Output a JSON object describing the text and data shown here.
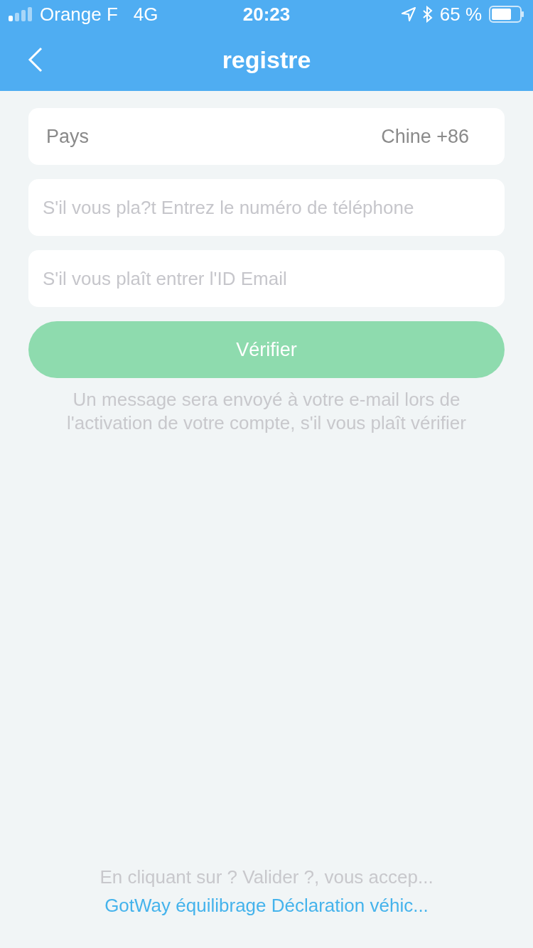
{
  "status_bar": {
    "carrier": "Orange F",
    "network": "4G",
    "time": "20:23",
    "battery": "65 %"
  },
  "nav": {
    "title": "registre"
  },
  "country": {
    "label": "Pays",
    "value": "Chine +86"
  },
  "phone": {
    "placeholder": "S'il vous pla?t Entrez le numéro de téléphone"
  },
  "email": {
    "placeholder": "S'il vous plaît entrer l'ID Email"
  },
  "verify_button": {
    "label": "Vérifier",
    "disabled": true
  },
  "message": "Un message sera envoyé à votre e-mail lors de l'activation de votre compte, s'il vous plaît vérifier",
  "footer": {
    "text": "En cliquant sur ? Valider ?, vous accep...",
    "link": "GotWay équilibrage Déclaration véhic..."
  }
}
